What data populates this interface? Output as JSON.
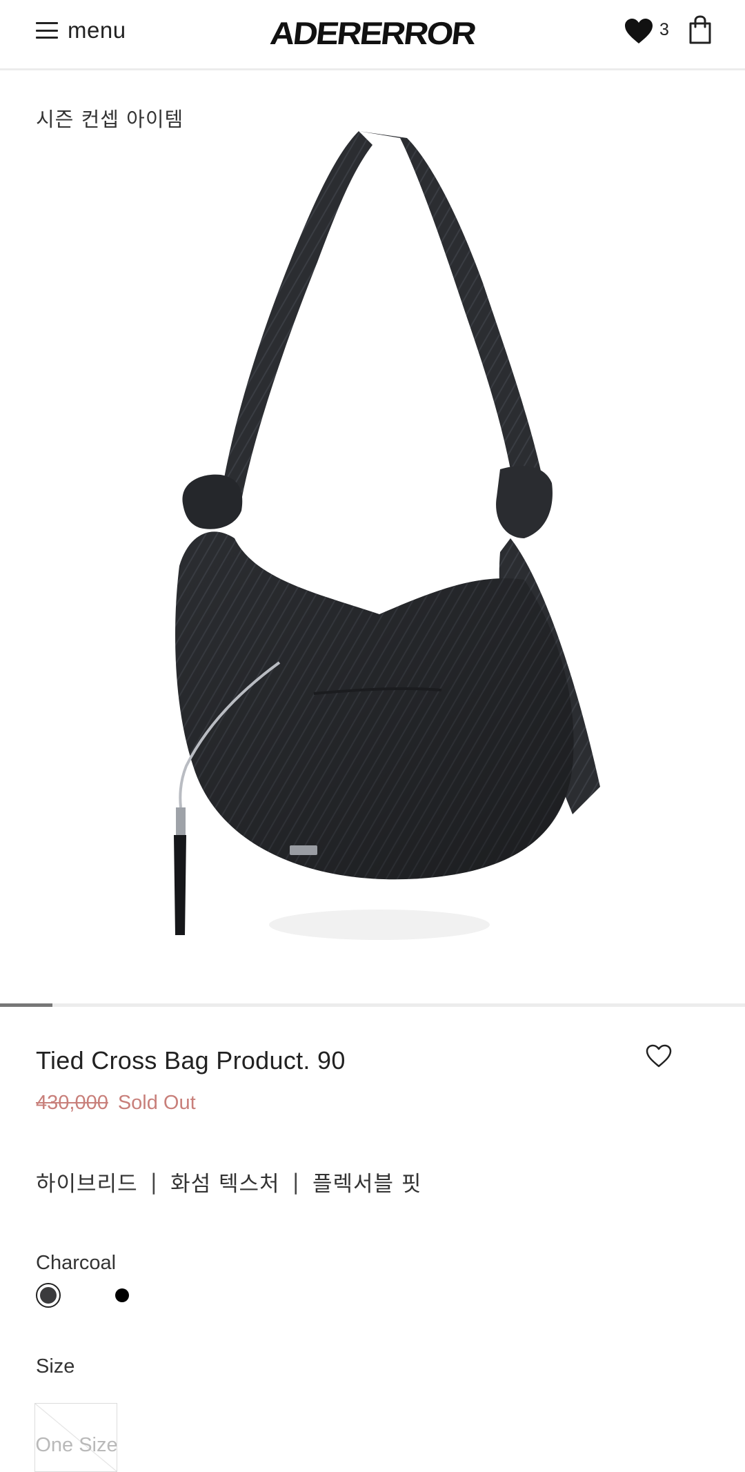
{
  "header": {
    "menu_label": "menu",
    "logo_text": "ADERERROR",
    "wishlist_count": "3"
  },
  "gallery": {
    "season_label": "시즌 컨셉 아이템",
    "product_image": "black shoulder bag with tied strap",
    "slide_progress": 0.07
  },
  "product": {
    "name": "Tied Cross Bag Product. 90",
    "original_price": "430,000",
    "status": "Sold Out",
    "features": [
      "하이브리드",
      "화섬 텍스처",
      "플렉서블 핏"
    ],
    "feature_separator": "|"
  },
  "color": {
    "selected_label": "Charcoal",
    "swatches": [
      {
        "name": "Charcoal",
        "hex": "#3b3b3d",
        "selected": true
      },
      {
        "name": "Black",
        "hex": "#000000",
        "selected": false
      }
    ]
  },
  "size": {
    "label": "Size",
    "options": [
      {
        "label": "One Size",
        "available": false
      }
    ]
  },
  "colors": {
    "price_accent": "#c87f7a",
    "text_primary": "#222222",
    "divider": "#ececec"
  }
}
